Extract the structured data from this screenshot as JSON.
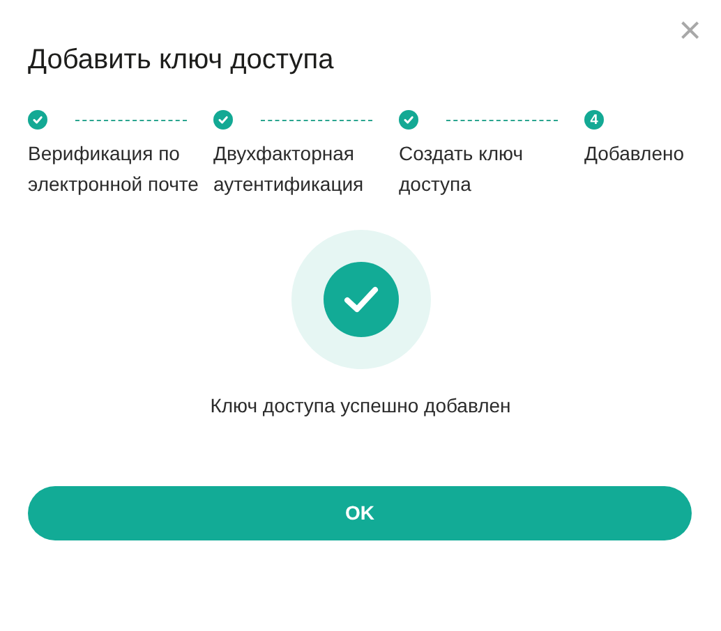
{
  "dialog": {
    "title": "Добавить ключ доступа",
    "close_label": "×"
  },
  "steps": [
    {
      "label": "Верификация по электронной почте",
      "done": true
    },
    {
      "label": "Двухфакторная аутентификация",
      "done": true
    },
    {
      "label": "Создать ключ доступа",
      "done": true
    },
    {
      "label": "Добавлено",
      "done": false,
      "number": "4"
    }
  ],
  "message": "Ключ доступа успешно добавлен",
  "button": "OK"
}
